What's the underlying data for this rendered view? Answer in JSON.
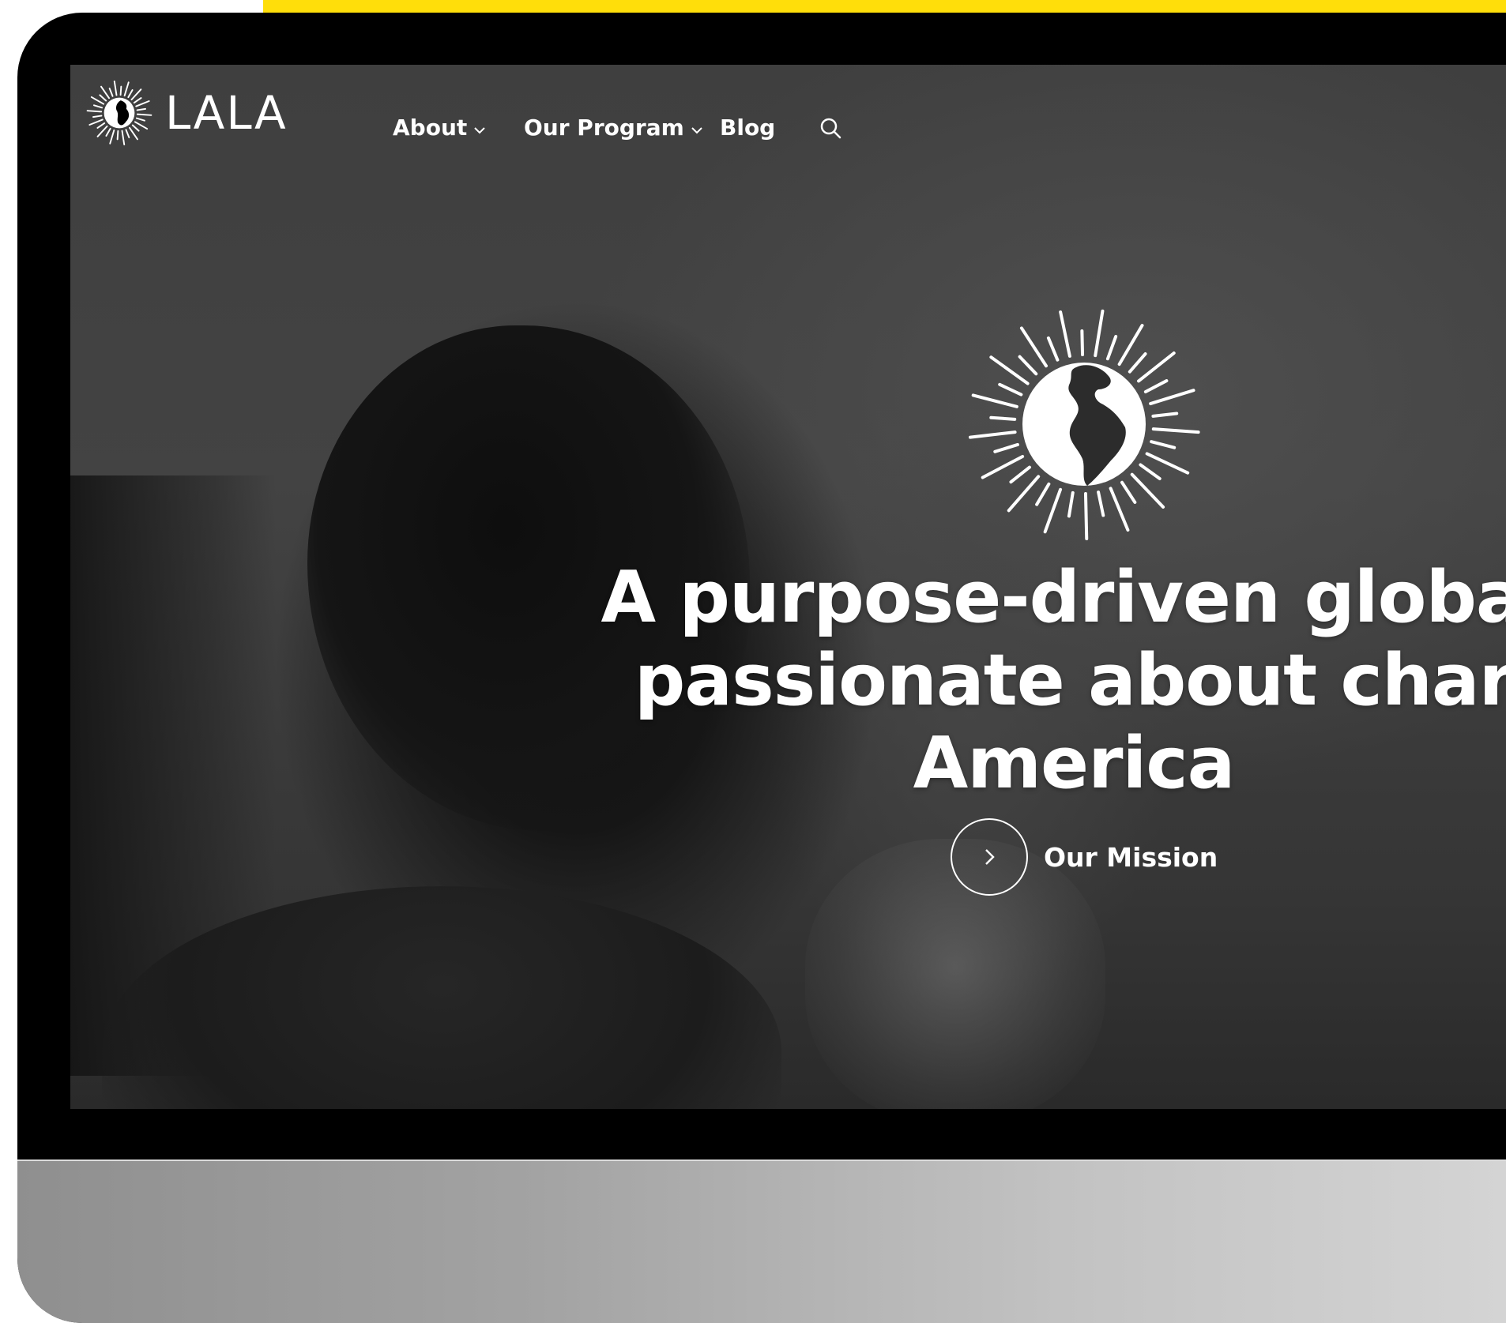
{
  "brand": {
    "logo_text": "LALA",
    "logo_icon": "globe-sunburst-icon"
  },
  "nav": {
    "items": [
      {
        "label": "About",
        "has_dropdown": true
      },
      {
        "label": "Our Program",
        "has_dropdown": true
      },
      {
        "label": "Blog",
        "has_dropdown": false
      }
    ],
    "search_icon": "search-icon"
  },
  "hero": {
    "emblem_icon": "globe-sunburst-icon",
    "headline_lines": [
      "A purpose-driven global",
      "passionate about char",
      "America"
    ],
    "cta_label": "Our Mission",
    "cta_icon": "chevron-right-icon"
  },
  "colors": {
    "accent_bar": "#ffde0a",
    "bezel": "#000000",
    "text": "#ffffff"
  }
}
